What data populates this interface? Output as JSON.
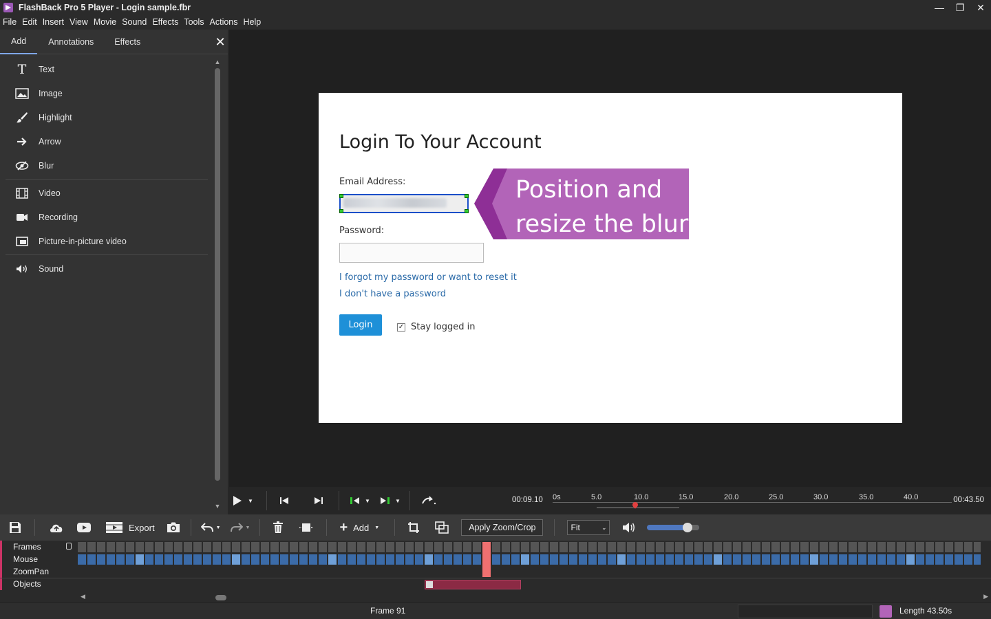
{
  "window": {
    "title": "FlashBack Pro 5 Player - Login sample.fbr"
  },
  "menu": [
    "File",
    "Edit",
    "Insert",
    "View",
    "Movie",
    "Sound",
    "Effects",
    "Tools",
    "Actions",
    "Help"
  ],
  "panel": {
    "tabs": [
      "Add",
      "Annotations",
      "Effects"
    ],
    "items": [
      {
        "label": "Text",
        "icon": "text-icon"
      },
      {
        "label": "Image",
        "icon": "image-icon"
      },
      {
        "label": "Highlight",
        "icon": "brush-icon"
      },
      {
        "label": "Arrow",
        "icon": "arrow-icon"
      },
      {
        "label": "Blur",
        "icon": "blur-icon"
      },
      {
        "label": "Video",
        "icon": "film-icon"
      },
      {
        "label": "Recording",
        "icon": "camera-icon"
      },
      {
        "label": "Picture-in-picture video",
        "icon": "pip-icon"
      },
      {
        "label": "Sound",
        "icon": "speaker-icon"
      }
    ]
  },
  "canvas": {
    "heading": "Login To Your Account",
    "email_label": "Email Address:",
    "password_label": "Password:",
    "forgot_link": "I forgot my password or want to reset it",
    "nopass_link": "I don't have a password",
    "login_button": "Login",
    "stay_logged_in": "Stay logged in",
    "callout_line1": "Position and",
    "callout_line2": "resize the blur"
  },
  "transport": {
    "current_time": "00:09.10",
    "end_time": "00:43.50",
    "ticks": [
      "0s",
      "5.0",
      "10.0",
      "15.0",
      "20.0",
      "25.0",
      "30.0",
      "35.0",
      "40.0"
    ]
  },
  "toolbar": {
    "export_label": "Export",
    "add_label": "Add",
    "apply_zoom_label": "Apply Zoom/Crop",
    "fit_value": "Fit",
    "volume_level": 0.75
  },
  "timeline": {
    "tracks": [
      "Frames",
      "Mouse",
      "ZoomPan",
      "Objects"
    ]
  },
  "status": {
    "frame": "Frame 91",
    "length": "Length 43.50s"
  },
  "colors": {
    "accent": "#b264b8",
    "link": "#2a6aa8",
    "button": "#1e90d8"
  }
}
